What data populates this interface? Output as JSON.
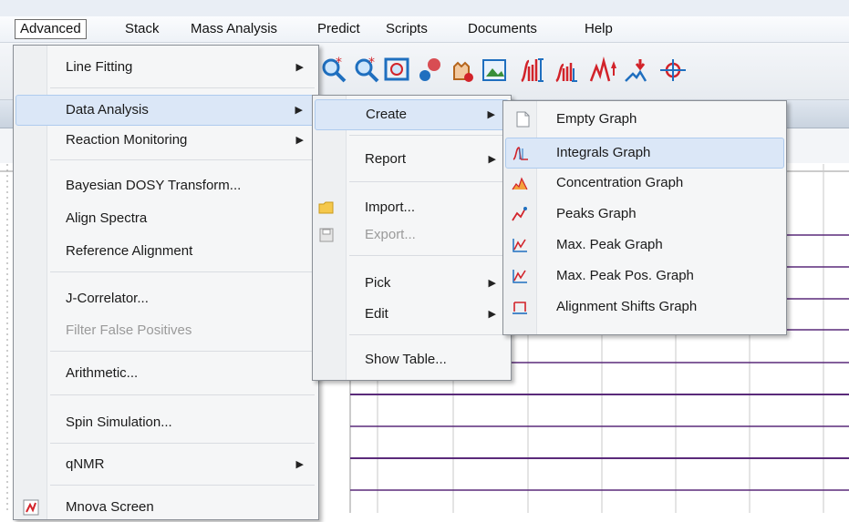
{
  "menubar": {
    "items": [
      {
        "label": "Advanced"
      },
      {
        "label": "Stack"
      },
      {
        "label": "Mass Analysis"
      },
      {
        "label": "Predict"
      },
      {
        "label": "Scripts"
      },
      {
        "label": "Documents"
      },
      {
        "label": "Help"
      }
    ]
  },
  "toolbar": {
    "icons": [
      "zoom-in-icon",
      "zoom-out-icon",
      "fit-view-icon",
      "peak-pick-icon",
      "pan-hand-icon",
      "image-icon",
      "integral-manual-icon",
      "integral-auto-icon",
      "peak-up-icon",
      "peak-down-icon",
      "crosshair-icon"
    ]
  },
  "advanced_menu": {
    "items": [
      {
        "label": "Line Fitting",
        "submenu": true
      },
      {
        "label": "Data Analysis",
        "submenu": true
      },
      {
        "label": "Reaction Monitoring",
        "submenu": true
      },
      {
        "label": "Bayesian DOSY Transform..."
      },
      {
        "label": "Align Spectra"
      },
      {
        "label": "Reference Alignment"
      },
      {
        "label": "J-Correlator..."
      },
      {
        "label": "Filter False Positives",
        "disabled": true
      },
      {
        "label": "Arithmetic..."
      },
      {
        "label": "Spin Simulation..."
      },
      {
        "label": "qNMR",
        "submenu": true
      },
      {
        "label": "Mnova Screen"
      }
    ]
  },
  "data_analysis_menu": {
    "items": [
      {
        "label": "Create",
        "submenu": true
      },
      {
        "label": "Report",
        "submenu": true
      },
      {
        "label": "Import...",
        "icon": "folder-icon"
      },
      {
        "label": "Export...",
        "icon": "save-icon",
        "disabled": true
      },
      {
        "label": "Pick",
        "submenu": true
      },
      {
        "label": "Edit",
        "submenu": true
      },
      {
        "label": "Show Table..."
      }
    ]
  },
  "create_menu": {
    "items": [
      {
        "label": "Empty Graph",
        "icon": "empty-page-icon"
      },
      {
        "label": "Integrals Graph",
        "icon": "integrals-graph-icon"
      },
      {
        "label": "Concentration Graph",
        "icon": "concentration-graph-icon"
      },
      {
        "label": "Peaks Graph",
        "icon": "peaks-graph-icon"
      },
      {
        "label": "Max. Peak Graph",
        "icon": "max-peak-graph-icon"
      },
      {
        "label": "Max. Peak Pos. Graph",
        "icon": "max-peak-pos-graph-icon"
      },
      {
        "label": "Alignment Shifts Graph",
        "icon": "alignment-shifts-graph-icon"
      }
    ]
  },
  "colors": {
    "highlight": "#dbe7f7",
    "spectrum_line": "#5a2a7a",
    "toolbar_red": "#d2232a",
    "toolbar_blue": "#1f6fbf"
  }
}
